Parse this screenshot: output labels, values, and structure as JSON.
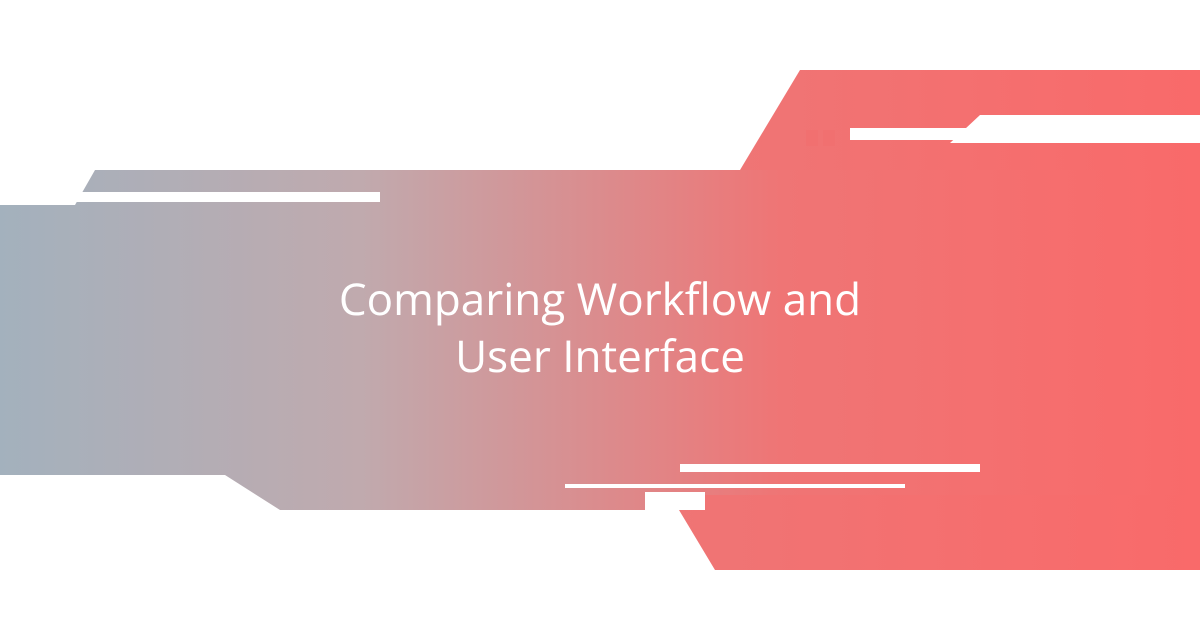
{
  "banner": {
    "title_line1": "Comparing Workflow and",
    "title_line2": "User Interface"
  }
}
